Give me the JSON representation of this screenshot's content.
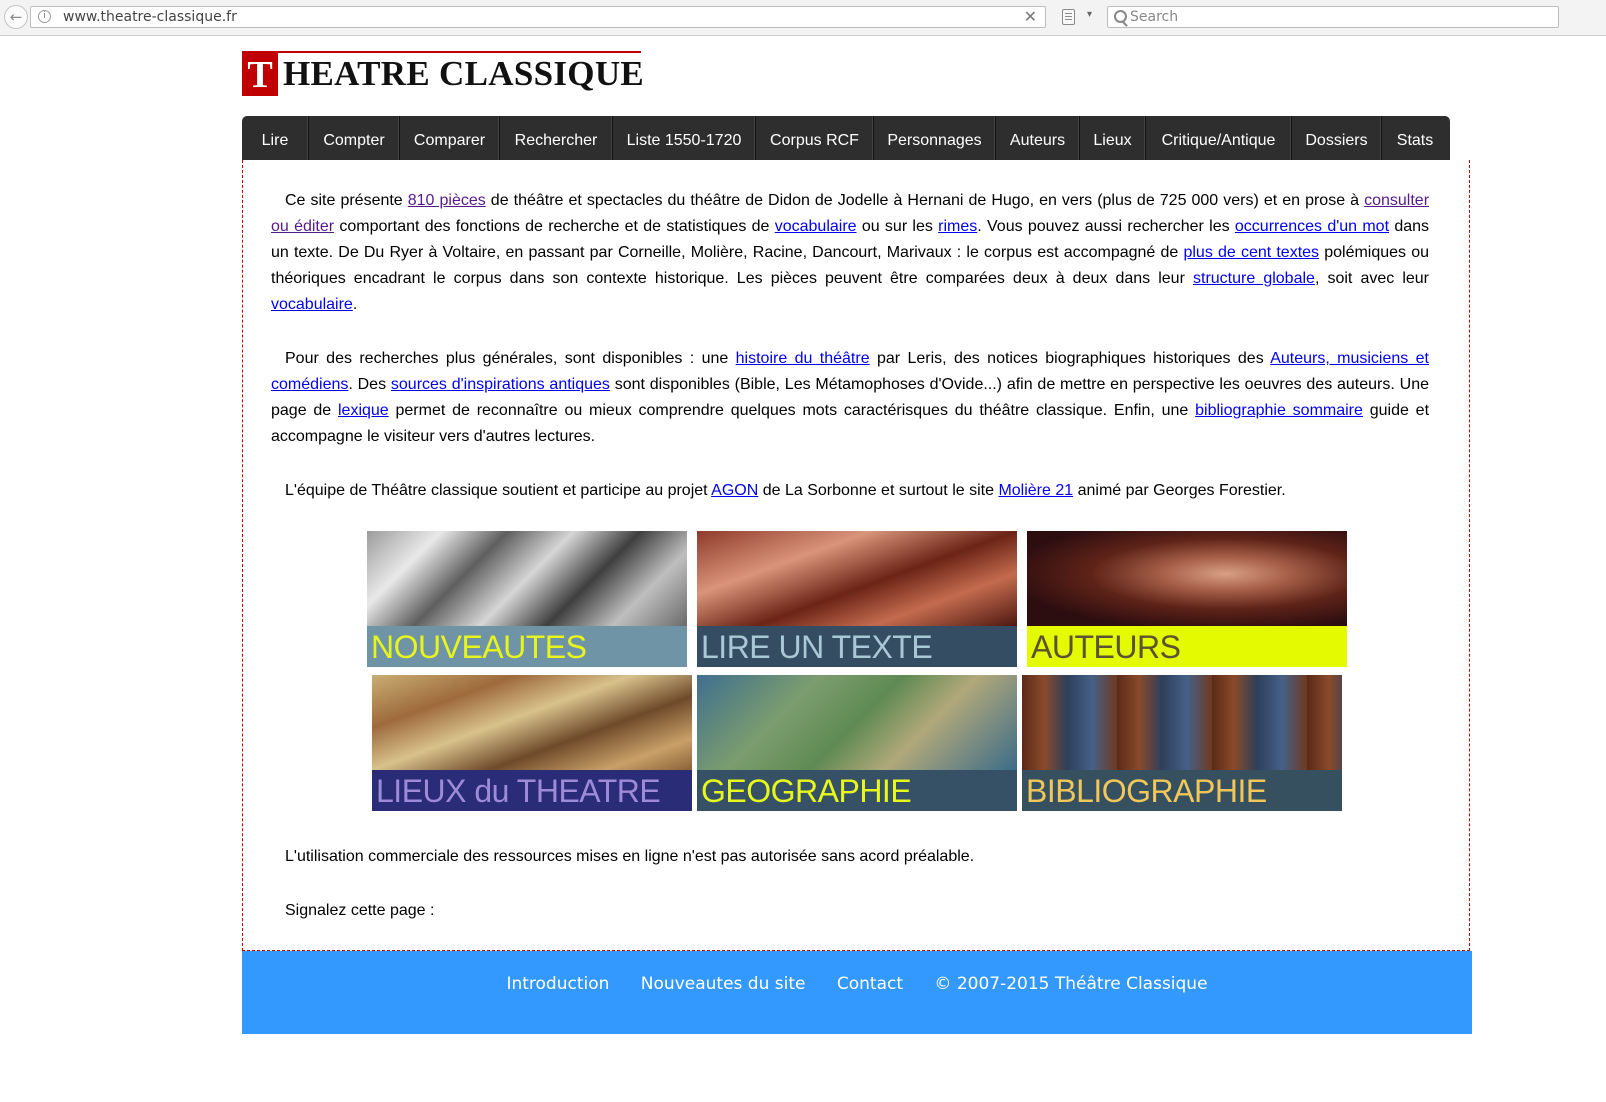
{
  "browser": {
    "url": "www.theatre-classique.fr",
    "search_placeholder": "Search",
    "back_glyph": "←",
    "clear_glyph": "✕",
    "dropdown_glyph": "▾",
    "info_glyph": "i"
  },
  "logo": {
    "initial": "T",
    "rest": "HEATRE CLASSIQUE"
  },
  "menu": [
    "Lire",
    "Compter",
    "Comparer",
    "Rechercher",
    "Liste 1550-1720",
    "Corpus RCF",
    "Personnages",
    "Auteurs",
    "Lieux",
    "Critique/Antique",
    "Dossiers",
    "Stats"
  ],
  "intro": {
    "p1": {
      "t1": "Ce site présente ",
      "l1": "810 pièces",
      "t2": " de théâtre et spectacles du théâtre de Didon de Jodelle à Hernani de Hugo, en vers (plus de 725 000 vers) et en prose à ",
      "l2": "consulter ou éditer",
      "t3": " comportant des fonctions de recherche et de statistiques de ",
      "l3": "vocabulaire",
      "t4": " ou sur les ",
      "l4": "rimes",
      "t5": ". Vous pouvez aussi rechercher les ",
      "l5": "occurrences d'un mot",
      "t6": " dans un texte. De Du Ryer à Voltaire, en passant par Corneille, Molière, Racine, Dancourt, Marivaux : le corpus est accompagné de ",
      "l6": "plus de cent textes",
      "t7": " polémiques ou théoriques encadrant le corpus dans son contexte historique. Les pièces peuvent être comparées deux à deux dans leur ",
      "l7": "structure globale",
      "t8": ", soit avec leur ",
      "l8": "vocabulaire",
      "t9": "."
    },
    "p2": {
      "t1": "Pour des recherches plus générales, sont disponibles : une ",
      "l1": "histoire du théâtre",
      "t2": " par Leris, des notices biographiques historiques des ",
      "l2": "Auteurs, musiciens et comédiens",
      "t3": ". Des ",
      "l3": "sources d'inspirations antiques",
      "t4": " sont disponibles (Bible, Les Métamophoses d'Ovide...) afin de mettre en perspective les oeuvres des auteurs. Une page de ",
      "l4": "lexique",
      "t5": " permet de reconnaître ou mieux comprendre quelques mots caractérisques du théâtre classique. Enfin, une ",
      "l5": "bibliographie sommaire",
      "t6": " guide et accompagne le visiteur vers d'autres lectures."
    },
    "p3": {
      "t1": "L'équipe de Théâtre classique soutient et participe au projet ",
      "l1": "AGON",
      "t2": " de La Sorbonne et surtout le site ",
      "l2": "Molière 21",
      "t3": " animé par Georges Forestier."
    }
  },
  "tiles": {
    "nouveautes": "NOUVEAUTES",
    "lire": "LIRE UN TEXTE",
    "auteurs": "AUTEURS",
    "lieux": "LIEUX du THEATRE",
    "geographie": "GEOGRAPHIE",
    "bibliographie": "BIBLIOGRAPHIE"
  },
  "notice": "L'utilisation commerciale des ressources mises en ligne n'est pas autorisée sans acord préalable.",
  "signal": "Signalez cette page :",
  "footer": {
    "introduction": "Introduction",
    "nouveautes": "Nouveautes du site",
    "contact": "Contact",
    "copyright": "© 2007-2015 Théâtre Classique"
  }
}
